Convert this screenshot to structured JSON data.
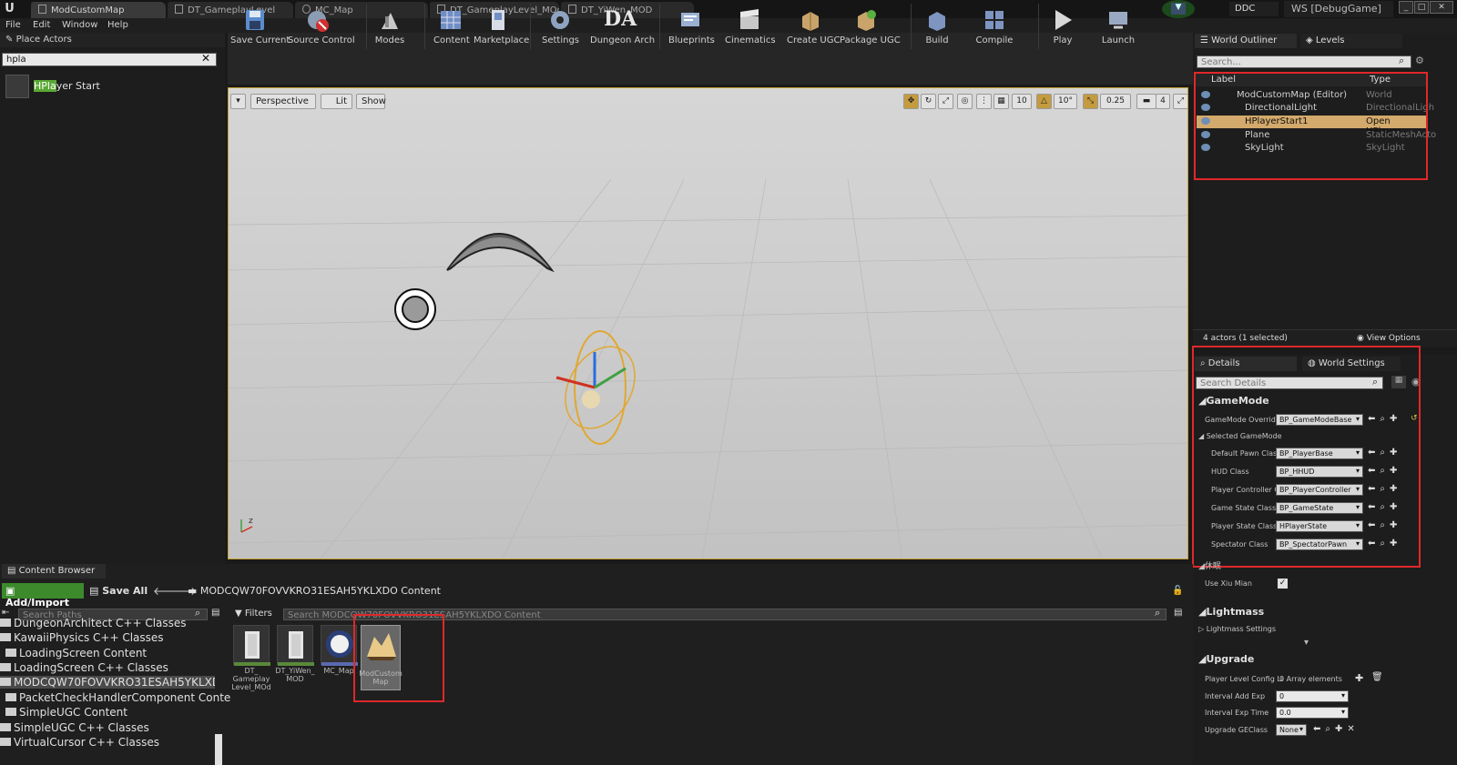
{
  "titlebar": {
    "tabs": [
      "ModCustomMap",
      "DT_GameplayLevel",
      "MC_Map",
      "DT_GameplayLevel_MOd",
      "DT_YiWen_MOD"
    ],
    "ddc": "DDC",
    "workspace": "WS [DebugGame]"
  },
  "menu": [
    "File",
    "Edit",
    "Window",
    "Help"
  ],
  "place_actors": {
    "title": "Place Actors",
    "search_value": "hpla",
    "result_highlight": "HPla",
    "result_rest": "yer Start"
  },
  "toolbar": {
    "items": [
      "Save Current",
      "Source Control",
      "Modes",
      "Content",
      "Marketplace",
      "Settings",
      "Dungeon Arch",
      "Blueprints",
      "Cinematics",
      "Create UGC",
      "Package UGC",
      "Build",
      "Compile",
      "Play",
      "Launch"
    ]
  },
  "viewport": {
    "perspective": "Perspective",
    "lit": "Lit",
    "show": "Show",
    "grid_snap": "10",
    "rot_snap": "10°",
    "scale_snap": "0.25",
    "cam_speed": "4"
  },
  "outliner": {
    "tab_world": "World Outliner",
    "tab_levels": "Levels",
    "search_placeholder": "Search...",
    "col_label": "Label",
    "col_type": "Type",
    "rows": [
      {
        "label": "ModCustomMap (Editor)",
        "type": "World"
      },
      {
        "label": "DirectionalLight",
        "type": "DirectionalLigh"
      },
      {
        "label": "HPlayerStart1",
        "type": "Open HPlayer"
      },
      {
        "label": "Plane",
        "type": "StaticMeshActo"
      },
      {
        "label": "SkyLight",
        "type": "SkyLight"
      }
    ],
    "status": "4 actors (1 selected)",
    "view_options": "View Options"
  },
  "details": {
    "tab_details": "Details",
    "tab_world_settings": "World Settings",
    "search_placeholder": "Search Details",
    "gamemode_category": "GameMode",
    "gamemode_override_label": "GameMode Override",
    "gamemode_override_value": "BP_GameModeBase",
    "selected_gamemode": "Selected GameMode",
    "rows": [
      {
        "label": "Default Pawn Class",
        "value": "BP_PlayerBase"
      },
      {
        "label": "HUD Class",
        "value": "BP_HHUD"
      },
      {
        "label": "Player Controller C",
        "value": "BP_PlayerController"
      },
      {
        "label": "Game State Class",
        "value": "BP_GameState"
      },
      {
        "label": "Player State Class",
        "value": "HPlayerState"
      },
      {
        "label": "Spectator Class",
        "value": "BP_SpectatorPawn"
      }
    ],
    "xiumian_category": "休眠",
    "use_xiu_mian_label": "Use Xiu Mian",
    "lightmass_category": "Lightmass",
    "lightmass_settings": "Lightmass Settings",
    "upgrade_category": "Upgrade",
    "player_level_config_label": "Player Level Config Li",
    "player_level_config_value": "0 Array elements",
    "interval_add_exp_label": "Interval Add Exp",
    "interval_add_exp_value": "0",
    "interval_exp_time_label": "Interval Exp Time",
    "interval_exp_time_value": "0.0",
    "upgrade_geclass_label": "Upgrade GEClass",
    "upgrade_geclass_value": "None"
  },
  "content_browser": {
    "title": "Content Browser",
    "add_import": "Add/Import",
    "save_all": "Save All",
    "path": "MODCQW70FOVVKRO31ESAH5YKLXDO Content",
    "search_paths_placeholder": "Search Paths",
    "filters": "Filters",
    "search_placeholder": "Search MODCQW70FOVVKRO31ESAH5YKLXDO Content",
    "folders": [
      "DungeonArchitect C++ Classes",
      "KawaiiPhysics C++ Classes",
      "LoadingScreen Content",
      "LoadingScreen C++ Classes",
      "MODCQW70FOVVKRO31ESAH5YKLXDO",
      "PacketCheckHandlerComponent Conte",
      "SimpleUGC Content",
      "SimpleUGC C++ Classes",
      "VirtualCursor C++ Classes"
    ],
    "assets": [
      {
        "label": "DT_ Gameplay Level_MOd"
      },
      {
        "label": "DT_YiWen_ MOD"
      },
      {
        "label": "MC_Map"
      },
      {
        "label": "ModCustom Map"
      }
    ]
  }
}
